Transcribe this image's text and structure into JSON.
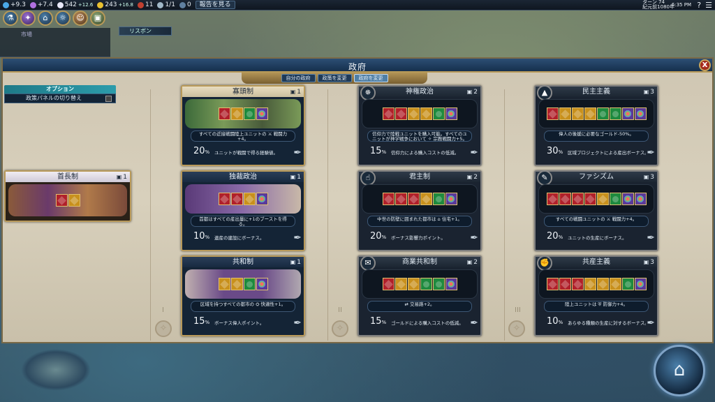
{
  "topbar": {
    "science": "+9.3",
    "culture": "+7.4",
    "faith": "542",
    "faith_delta": "+12.6",
    "gold": "243",
    "gold_delta": "+16.8",
    "trade": "11",
    "routes": "1/1",
    "envoys": "0",
    "report_label": "報告を見る",
    "turn": "ターン 74",
    "year": "紀元前1080年",
    "time": "6:35 PM",
    "help_icon": "?",
    "menu_icon": "☰"
  },
  "news": {
    "label": "リスボン"
  },
  "background_panel": {
    "label": "市場",
    "sub": ""
  },
  "panel": {
    "title": "政府",
    "close_icon": "X",
    "tabs": [
      "自分の政府",
      "政策を変更",
      "政府を変更"
    ],
    "active_tab": 2,
    "options_label": "オプション",
    "toggle_label": "政策パネルの切り替え"
  },
  "tiers": [
    "I",
    "II",
    "III"
  ],
  "chiefdom": {
    "name": "首長制",
    "slots": "1",
    "slot_colors": [
      "r",
      "y"
    ]
  },
  "governments": [
    {
      "name": "寡頭制",
      "slots": "1",
      "slot_colors": [
        "r",
        "y",
        "g",
        "w"
      ],
      "desc": "すべての近接戦闘陸上ユニットの ⚔ 戦闘力+4。",
      "pct": "20",
      "foot": "ユニットが戦闘で得る経験値。"
    },
    {
      "name": "独裁政治",
      "slots": "1",
      "slot_colors": [
        "r",
        "r",
        "y",
        "w"
      ],
      "desc": "首都はすべての産出量に+1のブーストを得る。",
      "pct": "10",
      "foot": "遺産の建設にボーナス。"
    },
    {
      "name": "共和制",
      "slots": "1",
      "slot_colors": [
        "y",
        "y",
        "g",
        "w"
      ],
      "desc": "区域を持つすべての都市の ⛭ 快適性+1。",
      "pct": "15",
      "foot": "ボーナス偉人ポイント。"
    },
    {
      "name": "神権政治",
      "slots": "2",
      "slot_colors": [
        "r",
        "r",
        "y",
        "y",
        "g",
        "w"
      ],
      "desc": "信仰力で陸戦ユニットを購入可能。すべてのユニットが神学戦争において ✧ 宗教戦闘力+5。",
      "pct": "15",
      "foot": "信仰力による購入コストの低減。"
    },
    {
      "name": "君主制",
      "slots": "2",
      "slot_colors": [
        "r",
        "r",
        "r",
        "y",
        "g",
        "w"
      ],
      "desc": "中世の防壁に囲まれた都市は ⌂ 住宅+1。",
      "pct": "20",
      "foot": "ボーナス影響力ポイント。"
    },
    {
      "name": "商業共和制",
      "slots": "2",
      "slot_colors": [
        "r",
        "y",
        "y",
        "g",
        "g",
        "w"
      ],
      "desc": "⇄ 交易路+2。",
      "pct": "15",
      "foot": "ゴールドによる購入コストの低減。"
    },
    {
      "name": "民主主義",
      "slots": "3",
      "slot_colors": [
        "r",
        "y",
        "y",
        "y",
        "g",
        "g",
        "w",
        "w"
      ],
      "desc": "偉人の後援に必要なゴールド-50%。",
      "pct": "30",
      "foot": "区域プロジェクトによる産出ボーナス。"
    },
    {
      "name": "ファシズム",
      "slots": "3",
      "slot_colors": [
        "r",
        "r",
        "r",
        "r",
        "y",
        "g",
        "w",
        "w"
      ],
      "desc": "すべての戦闘ユニットの ⚔ 戦闘力+4。",
      "pct": "20",
      "foot": "ユニットの生産にボーナス。"
    },
    {
      "name": "共産主義",
      "slots": "3",
      "slot_colors": [
        "r",
        "r",
        "r",
        "y",
        "y",
        "y",
        "g",
        "w"
      ],
      "desc": "陸上ユニットは ⛨ 防御力+4。",
      "pct": "10",
      "foot": "あらゆる種類の生産に対するボーナス。"
    }
  ]
}
